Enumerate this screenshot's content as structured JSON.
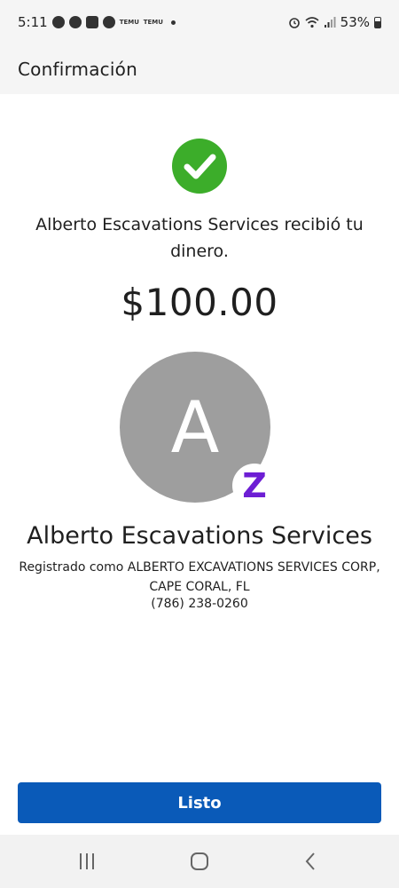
{
  "status_bar": {
    "time": "5:11",
    "temu_label_1": "TEMU",
    "temu_label_2": "TEMU",
    "battery": "53%"
  },
  "header": {
    "title": "Confirmación"
  },
  "confirmation": {
    "message": "Alberto Escavations Services recibió tu dinero.",
    "amount": "$100.00"
  },
  "recipient": {
    "avatar_initial": "A",
    "badge_symbol": "Z",
    "name": "Alberto Escavations Services",
    "registered_as": "Registrado como ALBERTO EXCAVATIONS SERVICES CORP, CAPE CORAL, FL",
    "phone": "(786) 238-0260"
  },
  "actions": {
    "done_label": "Listo"
  },
  "colors": {
    "accent": "#0a5ab8",
    "success": "#3cad2a",
    "zelle": "#6d1ed4",
    "avatar": "#9e9e9e"
  },
  "icons": {
    "status_left": [
      "whatsapp-icon",
      "facebook-icon",
      "messenger-icon",
      "temu-icon",
      "temu-icon"
    ],
    "status_right": [
      "alarm-icon",
      "wifi-icon",
      "signal-icon",
      "battery-icon"
    ],
    "confirmation": "check-circle-icon",
    "badge": "zelle-icon",
    "nav": [
      "recent-apps-icon",
      "home-icon",
      "back-icon"
    ]
  }
}
